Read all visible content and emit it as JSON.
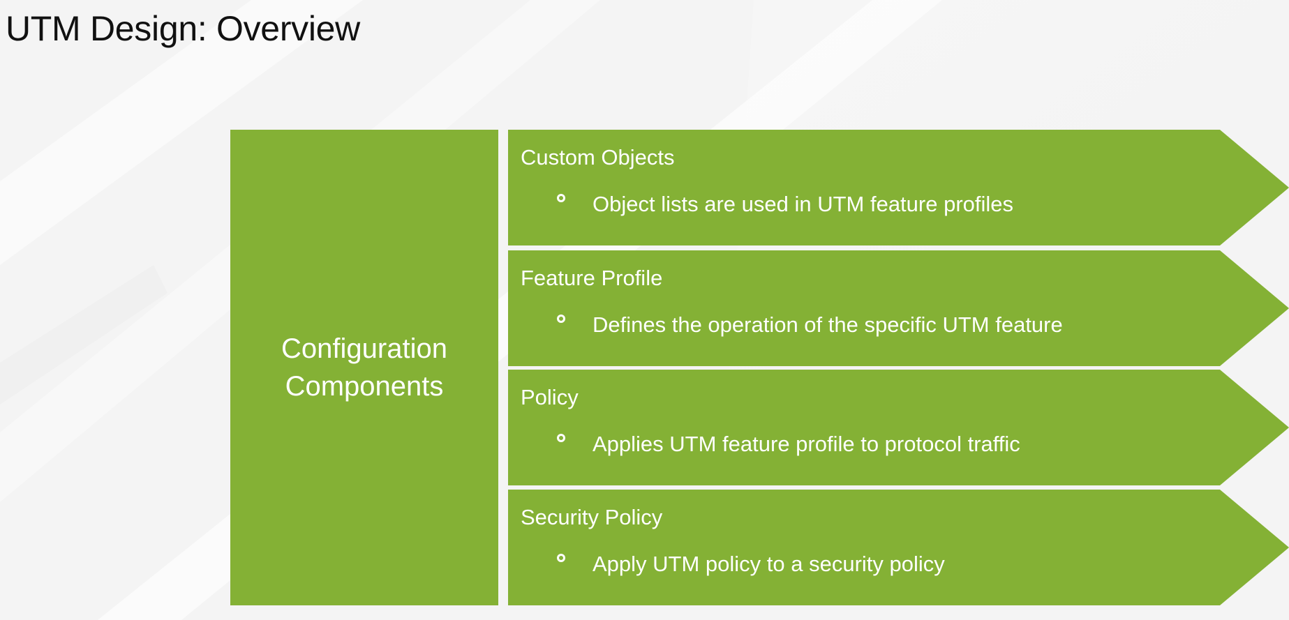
{
  "title": "UTM Design: Overview",
  "colors": {
    "green": "#84b135",
    "background": "#f5f5f5",
    "text": "#ffffff"
  },
  "diagram": {
    "center_label": "Configuration Components",
    "rows": [
      {
        "heading": "Custom Objects",
        "detail": "Object lists are used in UTM feature profiles"
      },
      {
        "heading": "Feature Profile",
        "detail": "Defines the operation of the specific UTM feature"
      },
      {
        "heading": "Policy",
        "detail": "Applies UTM feature profile to protocol traffic"
      },
      {
        "heading": "Security Policy",
        "detail": "Apply UTM policy to a security policy"
      }
    ]
  }
}
